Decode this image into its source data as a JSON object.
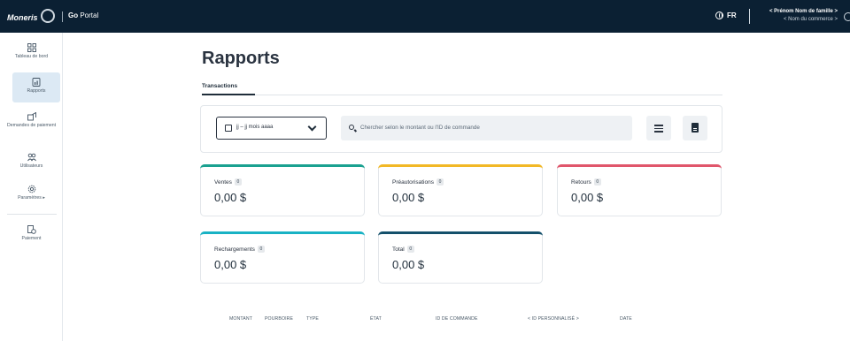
{
  "topbar": {
    "brand": "Moneris",
    "portal_prefix": "Go",
    "portal_suffix": "Portal",
    "language": "FR",
    "user_name": "< Prénom Nom de famille >",
    "store_name": "< Nom du commerce >"
  },
  "sidebar": {
    "items": [
      {
        "label": "Tableau de bord",
        "icon": "dashboard-icon"
      },
      {
        "label": "Rapports",
        "icon": "reports-icon"
      },
      {
        "label": "Demandes de paiement",
        "icon": "payment-request-icon"
      },
      {
        "label": "Utilisateurs",
        "icon": "users-icon"
      },
      {
        "label": "Paramètres",
        "icon": "settings-icon"
      },
      {
        "label": "Paiement",
        "icon": "payment-icon"
      }
    ]
  },
  "main": {
    "title": "Rapports",
    "tab": "Transactions",
    "date_value": "jj – jj mois aaaa",
    "search_placeholder": "Chercher selon le montant ou l'ID de commande",
    "cards": [
      {
        "label": "Ventes",
        "count": "0",
        "value": "0,00 $",
        "color": "#1aa190"
      },
      {
        "label": "Préautorisations",
        "count": "0",
        "value": "0,00 $",
        "color": "#f2b826"
      },
      {
        "label": "Retours",
        "count": "0",
        "value": "0,00 $",
        "color": "#e0566b"
      },
      {
        "label": "Rechargements",
        "count": "0",
        "value": "0,00 $",
        "color": "#19b2c4"
      },
      {
        "label": "Total",
        "count": "0",
        "value": "0,00 $",
        "color": "#14506b"
      }
    ],
    "table_headers": [
      "MONTANT",
      "POURBOIRE",
      "TYPE",
      "ÉTAT",
      "ID DE COMMANDE",
      "< ID PERSONNALISÉ >",
      "DATE"
    ]
  }
}
